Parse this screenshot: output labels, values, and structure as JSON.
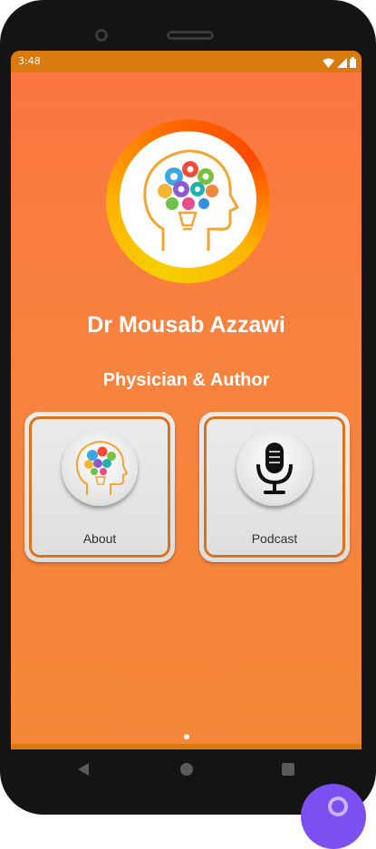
{
  "status_bar": {
    "time": "3:48",
    "icons": [
      "wifi-icon",
      "signal-icon",
      "battery-icon"
    ]
  },
  "app": {
    "logo": {
      "icon": "brain-head-icon"
    },
    "name": "Dr Mousab Azzawi",
    "subtitle": "Physician & Author",
    "cards": [
      {
        "label": "About",
        "icon": "brain-head-icon"
      },
      {
        "label": "Podcast",
        "icon": "microphone-icon"
      }
    ]
  },
  "nav_bar": {
    "buttons": [
      "back",
      "home",
      "recents"
    ]
  },
  "colors": {
    "status_bar": "#d97a0e",
    "background": "#f7833f",
    "card_border": "#d9731e",
    "fab": "#7c4ff0"
  }
}
